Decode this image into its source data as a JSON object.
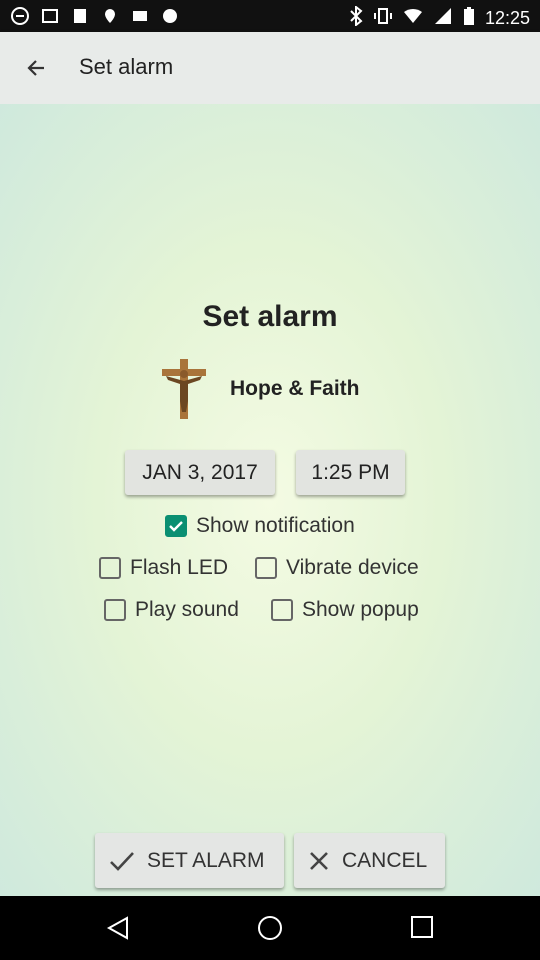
{
  "status_bar": {
    "time": "12:25"
  },
  "app_bar": {
    "title": "Set alarm"
  },
  "dialog": {
    "heading": "Set alarm",
    "brand_name": "Hope & Faith",
    "date_label": "JAN 3, 2017",
    "time_label": "1:25 PM"
  },
  "options": {
    "show_notification": {
      "label": "Show notification",
      "checked": true
    },
    "flash_led": {
      "label": "Flash LED",
      "checked": false
    },
    "vibrate_device": {
      "label": "Vibrate device",
      "checked": false
    },
    "play_sound": {
      "label": "Play sound",
      "checked": false
    },
    "show_popup": {
      "label": "Show popup",
      "checked": false
    }
  },
  "actions": {
    "set_alarm": "SET ALARM",
    "cancel": "CANCEL"
  },
  "colors": {
    "accent": "#0a8f72",
    "app_bar": "#e8ebe9"
  }
}
